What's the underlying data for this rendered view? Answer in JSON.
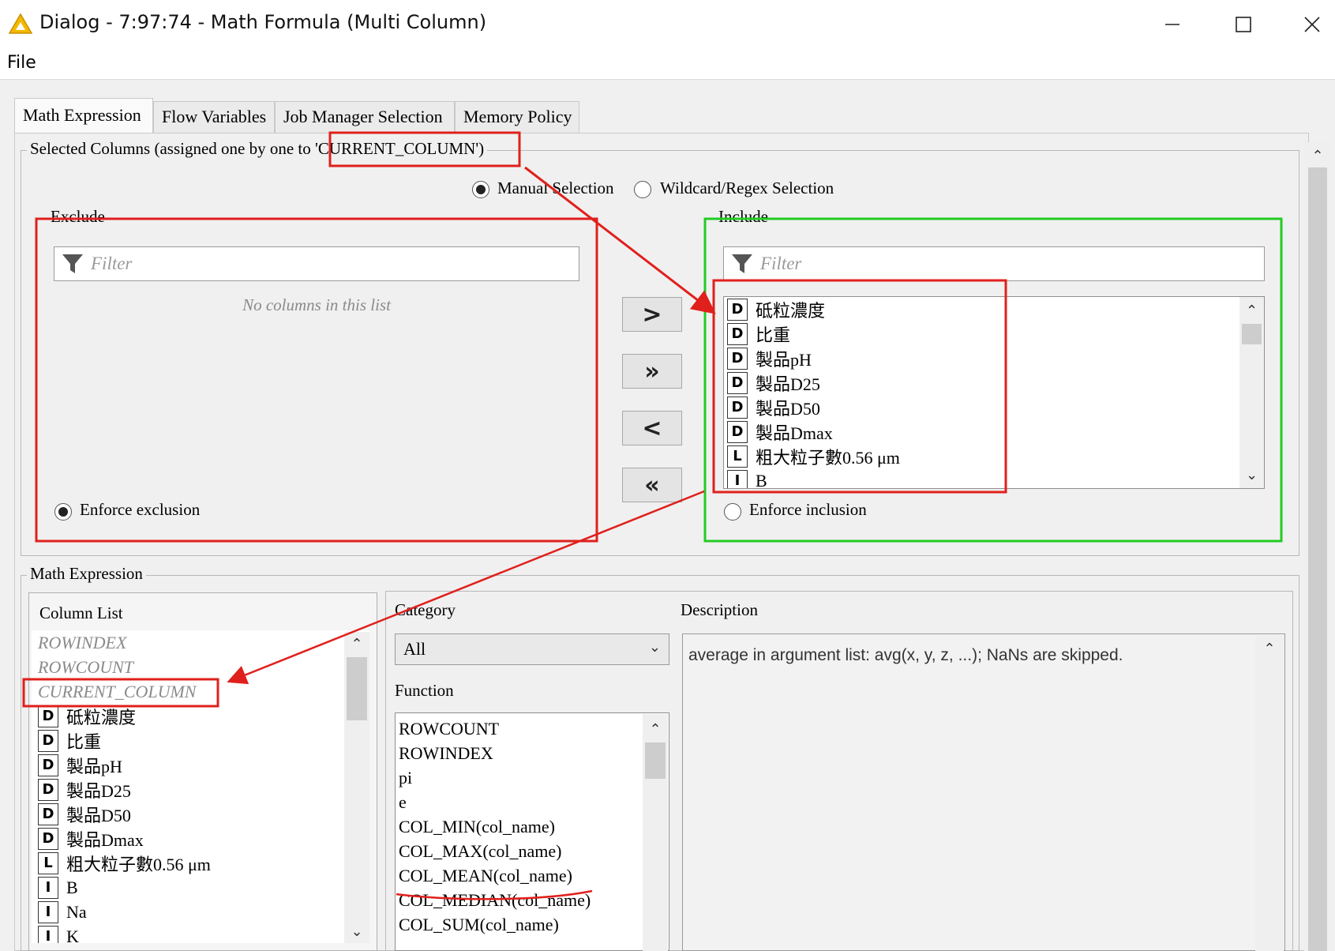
{
  "window": {
    "title": "Dialog - 7:97:74 - Math Formula (Multi Column)",
    "warning_icon": "warning-triangle-icon",
    "controls": [
      "minimize-icon",
      "maximize-icon",
      "close-icon"
    ]
  },
  "menu": {
    "file": "File"
  },
  "tabs": [
    "Math Expression",
    "Flow Variables",
    "Job Manager Selection",
    "Memory Policy"
  ],
  "selected_columns": {
    "legend_prefix": "Selected Columns (assigned one by one to ",
    "legend_token": "'CURRENT_COLUMN'",
    "legend_suffix": ")",
    "manual_label": "Manual Selection",
    "wildcard_label": "Wildcard/Regex Selection",
    "selected_mode": "manual",
    "exclude": {
      "title": "Exclude",
      "filter_placeholder": "Filter",
      "empty_text": "No columns in this list",
      "enforce_label": "Enforce exclusion",
      "enforce_selected": true
    },
    "include": {
      "title": "Include",
      "filter_placeholder": "Filter",
      "enforce_label": "Enforce inclusion",
      "enforce_selected": false,
      "items": [
        {
          "type": "D",
          "name": "砥粒濃度"
        },
        {
          "type": "D",
          "name": "比重"
        },
        {
          "type": "D",
          "name": "製品pH"
        },
        {
          "type": "D",
          "name": "製品D25"
        },
        {
          "type": "D",
          "name": "製品D50"
        },
        {
          "type": "D",
          "name": "製品Dmax"
        },
        {
          "type": "L",
          "name": "粗大粒子數0.56 μm"
        },
        {
          "type": "I",
          "name": "B"
        }
      ]
    },
    "move_buttons": [
      ">",
      "»",
      "<",
      "«"
    ]
  },
  "math_expression": {
    "legend": "Math Expression",
    "column_list": {
      "title": "Column List",
      "specials": [
        "ROWINDEX",
        "ROWCOUNT",
        "CURRENT_COLUMN"
      ],
      "items": [
        {
          "type": "D",
          "name": "砥粒濃度"
        },
        {
          "type": "D",
          "name": "比重"
        },
        {
          "type": "D",
          "name": "製品pH"
        },
        {
          "type": "D",
          "name": "製品D25"
        },
        {
          "type": "D",
          "name": "製品D50"
        },
        {
          "type": "D",
          "name": "製品Dmax"
        },
        {
          "type": "L",
          "name": "粗大粒子數0.56 μm"
        },
        {
          "type": "I",
          "name": "B"
        },
        {
          "type": "I",
          "name": "Na"
        },
        {
          "type": "I",
          "name": "K"
        }
      ]
    },
    "category_label": "Category",
    "category_value": "All",
    "function_label": "Function",
    "functions": [
      "ROWCOUNT",
      "ROWINDEX",
      "pi",
      "e",
      "COL_MIN(col_name)",
      "COL_MAX(col_name)",
      "COL_MEAN(col_name)",
      "COL_MEDIAN(col_name)",
      "COL_SUM(col_name)"
    ],
    "description_label": "Description",
    "description_text": "average in argument list: avg(x, y, z, ...); NaNs are skipped."
  },
  "annotation_colors": {
    "red": "#e0201c",
    "green": "#22cc22"
  }
}
